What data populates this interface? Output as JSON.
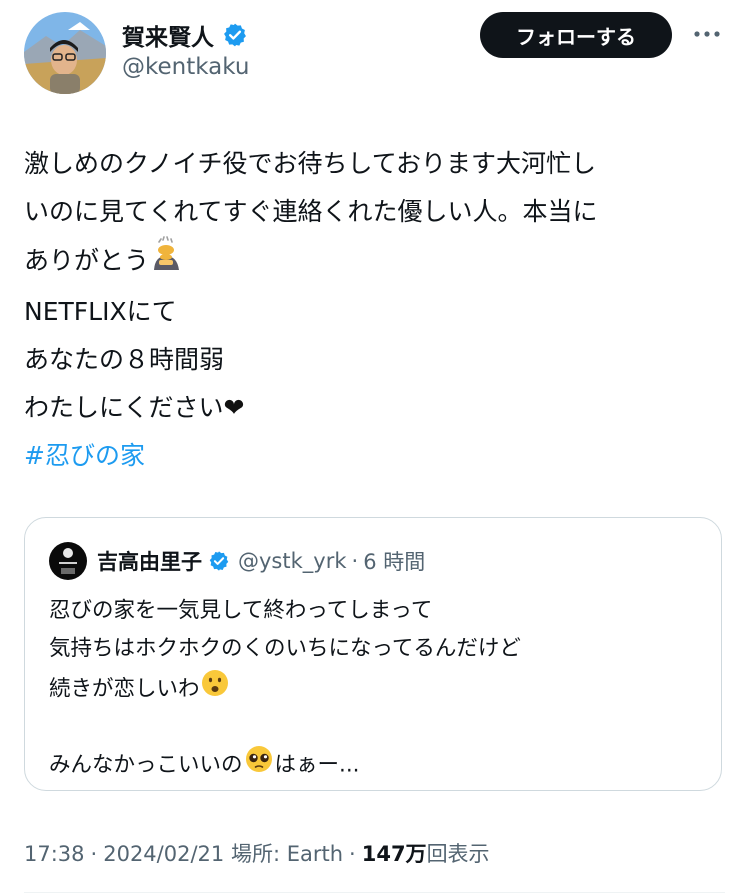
{
  "author": {
    "display_name": "賀来賢人",
    "handle": "@kentkaku",
    "verified": true
  },
  "follow_button": {
    "label": "フォローする"
  },
  "more_icon": "more-horizontal-icon",
  "tweet": {
    "lines": [
      "激しめのクノイチ役でお待ちしております大河忙し",
      "いのに見てくれてすぐ連絡くれた優しい人。本当に",
      "ありがとう",
      " NETFLIXにて",
      "あなたの８時間弱",
      "わたしにください"
    ],
    "emoji_bow": "person-bowing-emoji",
    "emoji_heart": "❤",
    "hashtag": "#忍びの家"
  },
  "quote": {
    "display_name": "吉高由里子",
    "handle": "@ystk_yrk",
    "separator": "·",
    "time": "6 時間",
    "lines": [
      "忍びの家を一気見して終わってしまって",
      "気持ちはホクホクのくのいちになってるんだけど",
      "続きが恋しいわ",
      "",
      "みんなかっこいいの"
    ],
    "emoji_frown": "frowning-face-emoji",
    "emoji_pleading": "pleading-face-emoji",
    "tail": "はぁー..."
  },
  "meta": {
    "time": "17:38",
    "date": "2024/02/21",
    "location": "場所: Earth",
    "views_count": "147万",
    "views_label": "回表示",
    "separator": "·"
  },
  "colors": {
    "text": "#0f1419",
    "secondary": "#536471",
    "link": "#1d9bf0",
    "verified": "#1d9bf0",
    "border": "#cfd9de"
  }
}
